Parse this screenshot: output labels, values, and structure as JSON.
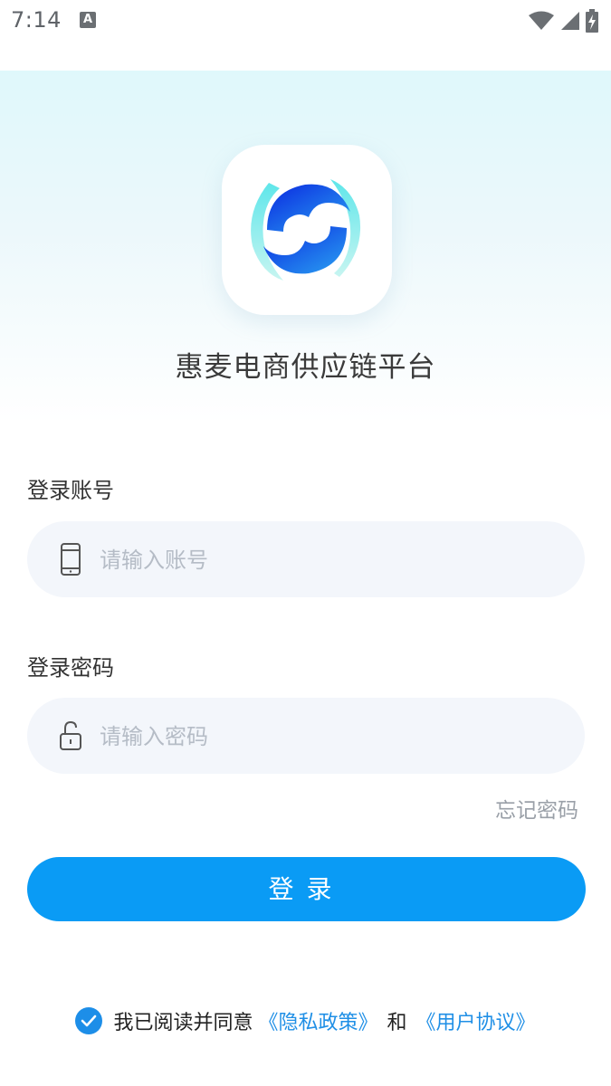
{
  "status_bar": {
    "time": "7:14",
    "notification_icon": "A",
    "wifi_icon": "wifi-icon",
    "signal_icon": "signal-icon",
    "battery_icon": "battery-charging-icon"
  },
  "app": {
    "title": "惠麦电商供应链平台",
    "logo_icon": "app-logo-icon"
  },
  "form": {
    "account_label": "登录账号",
    "account_placeholder": "请输入账号",
    "account_icon": "phone-icon",
    "password_label": "登录密码",
    "password_placeholder": "请输入密码",
    "password_icon": "lock-icon",
    "forgot_password": "忘记密码",
    "login_button": "登录"
  },
  "agreement": {
    "checked": true,
    "prefix": "我已阅读并同意",
    "privacy_link": "《隐私政策》",
    "and": "和",
    "user_link": "《用户协议》"
  },
  "colors": {
    "primary": "#0a9bf5",
    "link": "#1f8fe6",
    "input_bg": "#f3f6fb"
  }
}
